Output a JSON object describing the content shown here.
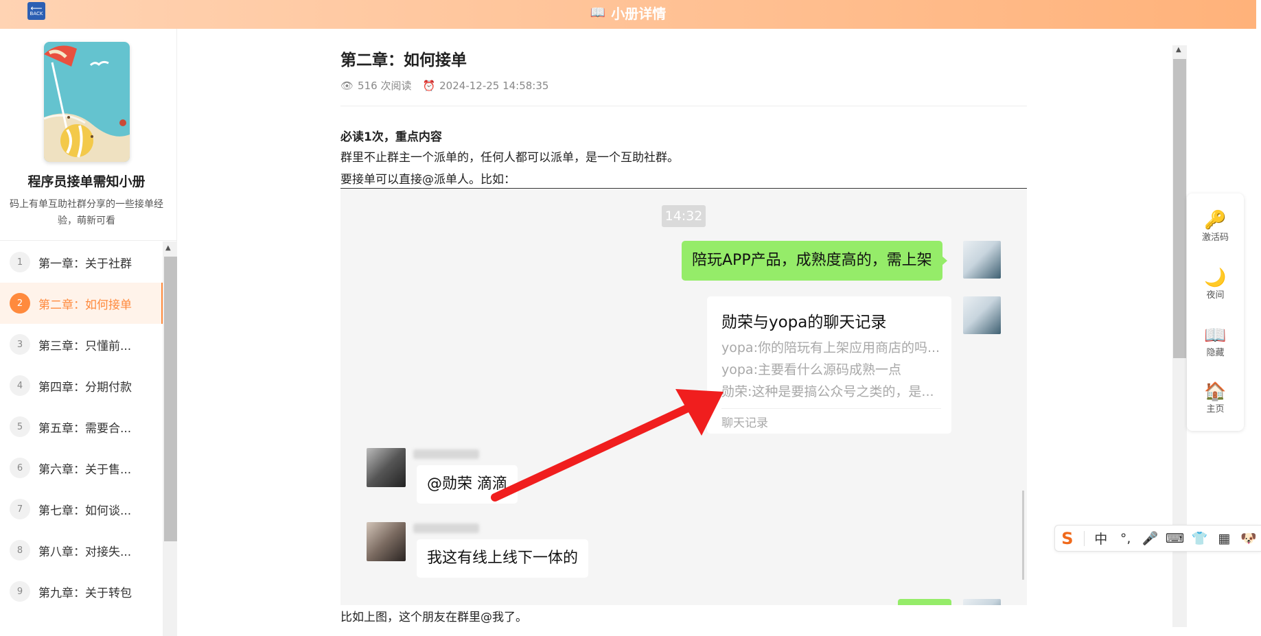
{
  "header": {
    "back_label": "BACK",
    "title": "小册详情"
  },
  "sidebar": {
    "book_title": "程序员接单需知小册",
    "book_desc": "码上有单互助社群分享的一些接单经验，萌新可看",
    "toc": [
      {
        "num": "1",
        "label": "第一章：关于社群"
      },
      {
        "num": "2",
        "label": "第二章：如何接单"
      },
      {
        "num": "3",
        "label": "第三章：只懂前..."
      },
      {
        "num": "4",
        "label": "第四章：分期付款"
      },
      {
        "num": "5",
        "label": "第五章：需要合..."
      },
      {
        "num": "6",
        "label": "第六章：关于售..."
      },
      {
        "num": "7",
        "label": "第七章：如何谈..."
      },
      {
        "num": "8",
        "label": "第八章：对接失..."
      },
      {
        "num": "9",
        "label": "第九章：关于转包"
      }
    ],
    "active_index": 1
  },
  "article": {
    "title": "第二章：如何接单",
    "reads": "516 次阅读",
    "date": "2024-12-25 14:58:35",
    "bold_line": "必读1次，重点内容",
    "para1": "群里不止群主一个派单的，任何人都可以派单，是一个互助社群。",
    "para2": "要接单可以直接@派单人。比如：",
    "para3": "比如上图，这个朋友在群里@我了。"
  },
  "chat": {
    "time": "14:32",
    "green_msg": "陪玩APP产品，成熟度高的，需上架",
    "record_title": "勋荣与yopa的聊天记录",
    "record_lines": [
      "yopa:你的陪玩有上架应用商店的吗...",
      "yopa:主要看什么源码成熟一点",
      "勋荣:这种是要搞公众号之类的，是..."
    ],
    "record_footer": "聊天记录",
    "msg_mention": "@勋荣 滴滴",
    "msg_online": "我这有线上线下一体的"
  },
  "tools": [
    {
      "icon": "key-icon",
      "label": "激活码"
    },
    {
      "icon": "moon-icon",
      "label": "夜间"
    },
    {
      "icon": "book-icon",
      "label": "隐藏"
    },
    {
      "icon": "home-icon",
      "label": "主页"
    }
  ],
  "ime": {
    "mode": "中"
  },
  "colors": {
    "accent": "#ff8a3d",
    "header_gradient_start": "#ffd3b3",
    "header_gradient_end": "#ffb27a",
    "chat_green": "#95ec69",
    "arrow_red": "#f01e1e"
  }
}
